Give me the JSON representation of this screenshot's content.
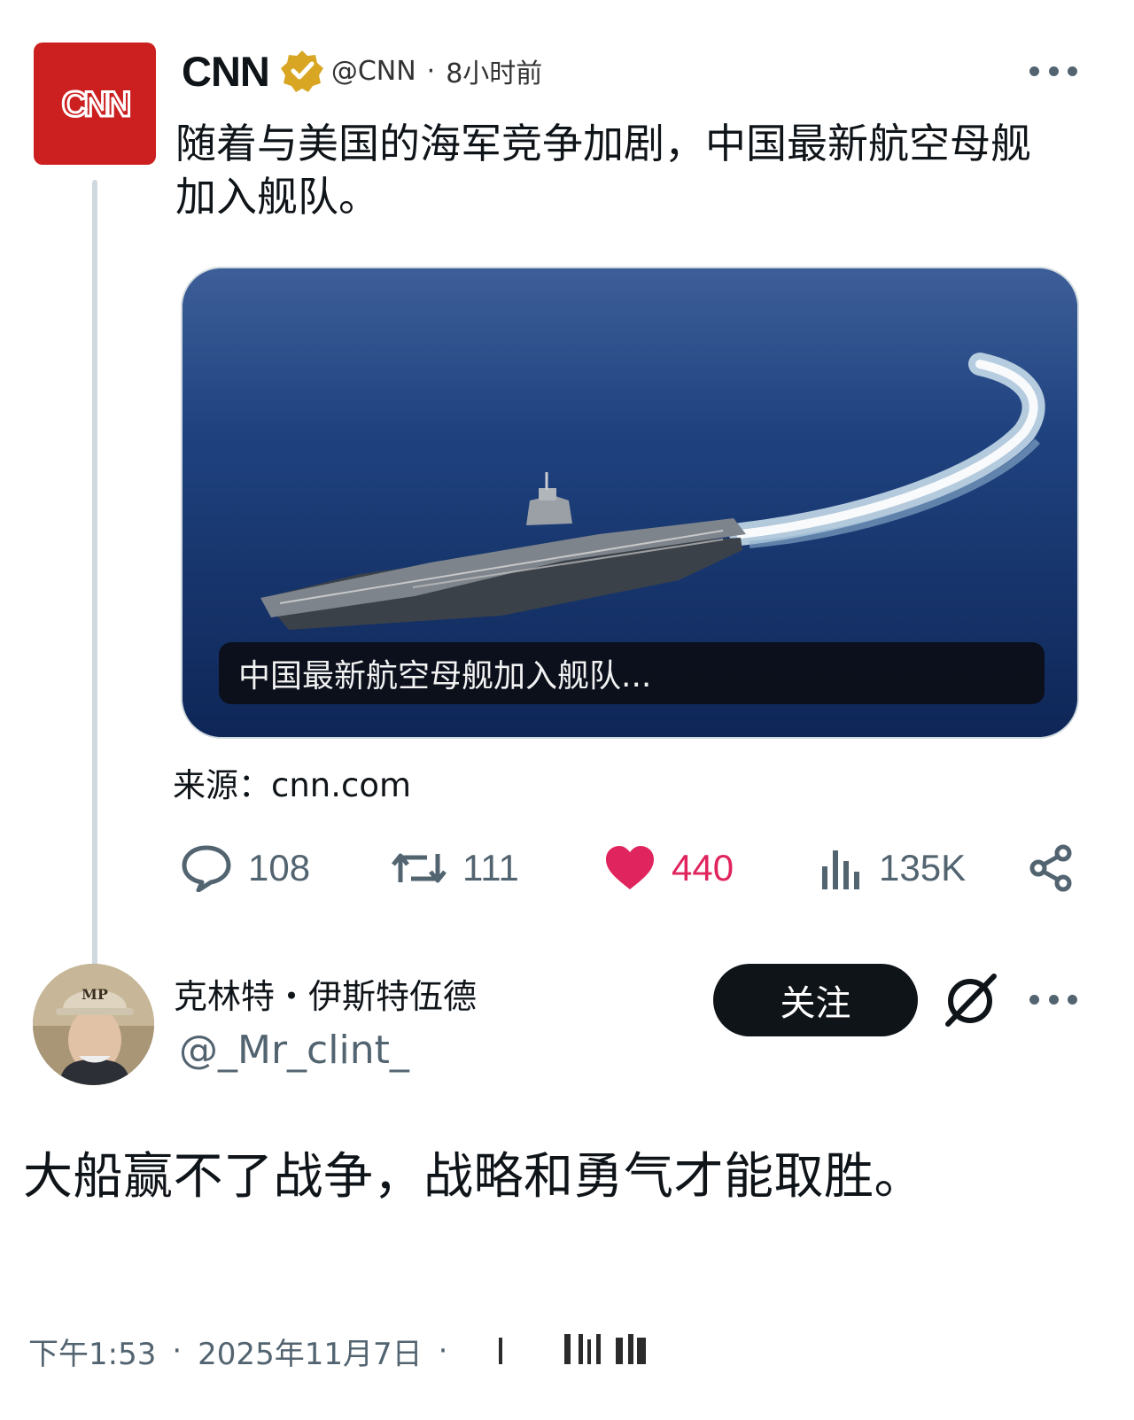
{
  "quoted_post": {
    "author_name": "CNN",
    "logo_text": "CNN",
    "handle": "@CNN",
    "separator": "·",
    "time": "8小时前",
    "text": "随着与美国的海军竞争加剧，中国最新航空母舰加入舰队。",
    "media_caption": "中国最新航空母舰加入舰队...",
    "source": "来源：cnn.com",
    "brand_color": "#cc1f1f",
    "actions": {
      "replies": "108",
      "reposts": "111",
      "likes": "440",
      "views": "135K"
    }
  },
  "reply": {
    "author_name": "克林特・伊斯特伍德",
    "handle": "@_Mr_clint_",
    "avatar_cap_text": "MP",
    "follow_label": "关注",
    "text": "大船赢不了战争，战略和勇气才能取胜。",
    "meta": {
      "time": "下午1:53",
      "separator": "·",
      "date": "2025年11月7日",
      "separator2": "·"
    }
  },
  "colors": {
    "like": "#e0245e",
    "text_secondary": "#536471",
    "verified_gold": "#d8a622"
  }
}
